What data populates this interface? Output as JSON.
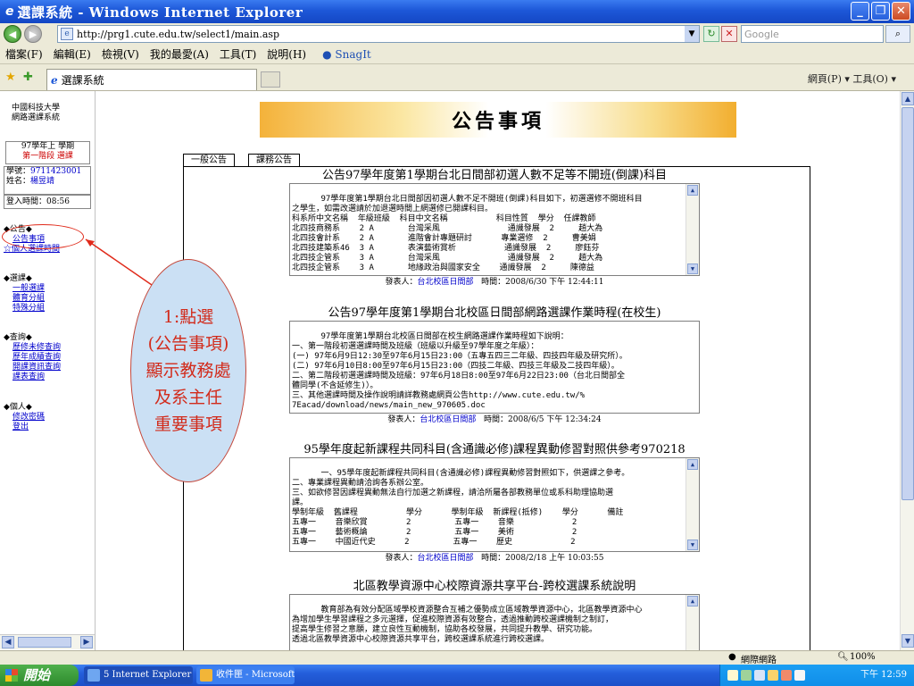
{
  "window": {
    "title": "選課系統 - Windows Internet Explorer"
  },
  "address_bar": {
    "url": "http://prg1.cute.edu.tw/select1/main.asp",
    "search_placeholder": "Google"
  },
  "menubar": {
    "items": [
      "檔案(F)",
      "編輯(E)",
      "檢視(V)",
      "我的最愛(A)",
      "工具(T)",
      "說明(H)"
    ],
    "snagit": "SnagIt"
  },
  "tabbar": {
    "tab_title": "選課系統",
    "tools_text": "網頁(P) ▾  工具(O) ▾"
  },
  "sidebar": {
    "school": "中國科技大學",
    "system": "網路選課系統",
    "term": "97學年上 學期",
    "stage": "第一階段 選課",
    "student_id_label": "學號：",
    "student_id": "9711423001",
    "name_label": "姓名：",
    "name": "楊昱靖",
    "login_label": "登入時間：",
    "login_time": "08:56",
    "sections": [
      {
        "head": "◆公告◆",
        "items": [
          "公告事項",
          "☆個人選課時間"
        ]
      },
      {
        "head": "◆選課◆",
        "items": [
          "一般選課",
          "體育分組",
          "特殊分組"
        ]
      },
      {
        "head": "◆查詢◆",
        "items": [
          "歷修未修查詢",
          "歷年成績查詢",
          "開課資訊查詢",
          "課表查詢"
        ]
      },
      {
        "head": "◆個人◆",
        "items": [
          "修改密碼",
          "登出"
        ]
      }
    ]
  },
  "content": {
    "banner_title": "公告事項",
    "subtabs": [
      "一般公告",
      "課務公告"
    ],
    "announcements": [
      {
        "title": "公告97學年度第1學期台北日間部初選人數不足等不開班(倒課)科目",
        "body": "97學年度第1學期台北日間部因初選人數不足不開班(倒課)科目如下，初選選修不開班科目\n之學生，如需改選請於加退選時間上網選修已開課科目。\n科系所中文名稱  年級班級  科目中文名稱          科目性質  學分  任課教師\n北四技商務系    2 A       台灣采風              通識發展  2     趙大為\n北四技會計系    2 A       進階會計專題研討      專業選修  2     曹美娟\n北四技建築系46  3 A       表演藝術賞析          通識發展  2     廖鈺芬\n北四技企管系    3 A       台灣采風              通識發展  2     趙大為\n北四技企管系    3 A       地緣政治與國家安全    通識發展  2     陳德益",
        "by_label": "發表人：",
        "by": "台北校區日間部",
        "time_label": "時間：",
        "time": "2008/6/30 下午 12:44:11"
      },
      {
        "title": "公告97學年度第1學期台北校區日間部網路選課作業時程(在校生)",
        "body": "97學年度第1學期台北校區日間部在校生網路選課作業時程如下說明：\n一、第一階段初選選課時間及班級（班級以升級至97學年度之年級）：\n(一) 97年6月9日12:30至97年6月15日23:00（五專五四三二年級、四技四年級及研究所）。\n(二) 97年6月10日8:00至97年6月15日23:00（四技二年級、四技三年級及二技四年級）。\n二、第二階段初選選課時間及班級：97年6月18日8:00至97年6月22日23:00（台北日間部全\n體同學(不含延修生)）。\n三、其他選課時間及操作說明請詳教務處網頁公告http://www.cute.edu.tw/%\n7Eacad/download/news/main_new_970605.doc",
        "by_label": "發表人：",
        "by": "台北校區日間部",
        "time_label": "時間：",
        "time": "2008/6/5 下午 12:34:24"
      },
      {
        "title": "95學年度起新課程共同科目(含通識必修)課程異動修習對照供參考970218",
        "body": "一、95學年度起新課程共同科目(含通識必修)課程異動修習對照如下，供選課之參考。\n二、專業課程異動請洽詢各系辦公室。\n三、如欲修習因課程異動無法自行加選之新課程，請洽所屬各部教務單位或系科助理協助選\n課。\n學制年級  舊課程          學分      學制年級  新課程(抵修)    學分      備註\n五專一    音樂欣賞        2         五專一    音樂            2\n五專一    藝術概論        2         五專一    美術            2\n五專一    中國近代史      2         五專一    歷史            2",
        "by_label": "發表人：",
        "by": "台北校區日間部",
        "time_label": "時間：",
        "time": "2008/2/18 上午 10:03:55"
      },
      {
        "title": "北區教學資源中心校際資源共享平台-跨校選課系統說明",
        "body": "教育部為有效分配區域學校資源整合互補之優勢成立區域教學資源中心，北區教學資源中心\n為增加學生學習課程之多元選擇，促進校際資源有效整合，透過推動跨校選課機制之制訂，\n提高學生修習之意願，建立良性互動機制，協助各校發展，共同提升教學、研究功能。\n透過北區教學資源中心校際資源共享平台，跨校選課系統進行跨校選課。"
      }
    ]
  },
  "callout": {
    "lines": [
      "1:點選",
      "(公告事項)",
      "顯示教務處",
      "及系主任",
      "重要事項"
    ]
  },
  "statusbar": {
    "zone": "網際網路",
    "zoom": "100%"
  },
  "taskbar": {
    "start": "開始",
    "tasks": [
      "5 Internet Explorer",
      "收件匣 - Microsoft O..."
    ],
    "clock": "下午 12:59"
  },
  "colors": {
    "titlebar": "#1d57d8",
    "callout_text": "#d22b1b",
    "link": "#0000cc",
    "banner_orange": "#f4b23a"
  }
}
